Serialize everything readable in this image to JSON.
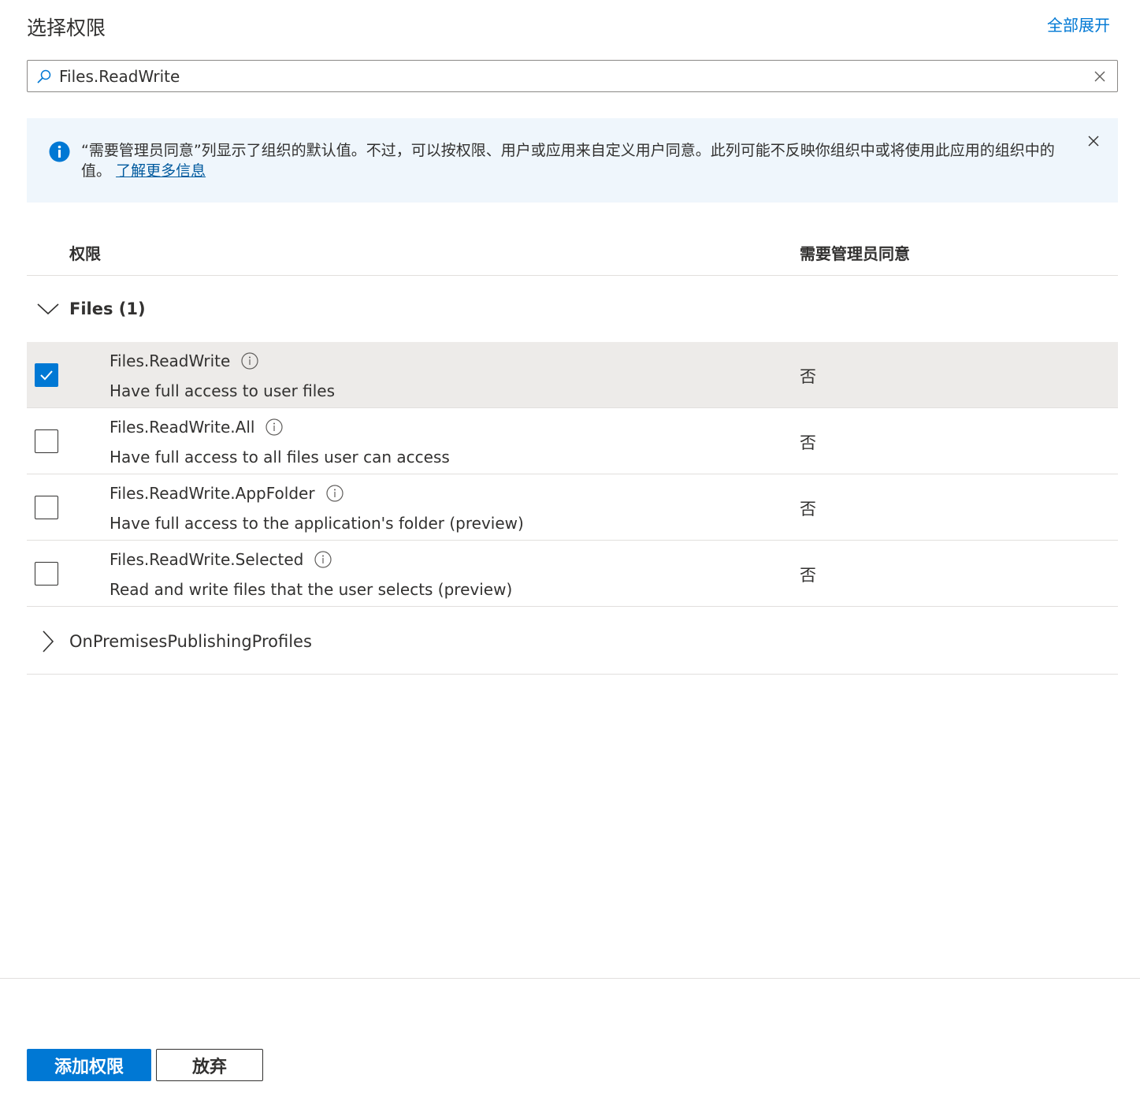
{
  "header": {
    "title": "选择权限",
    "expand_all": "全部展开"
  },
  "search": {
    "value": "Files.ReadWrite"
  },
  "info_bar": {
    "text": "“需要管理员同意”列显示了组织的默认值。不过，可以按权限、用户或应用来自定义用户同意。此列可能不反映你组织中或将使用此应用的组织中的值。",
    "link": "了解更多信息"
  },
  "table": {
    "col_permission": "权限",
    "col_admin_consent": "需要管理员同意"
  },
  "groups": [
    {
      "label": "Files (1)",
      "expanded": true,
      "items": [
        {
          "name": "Files.ReadWrite",
          "description": "Have full access to user files",
          "admin_consent": "否",
          "checked": true
        },
        {
          "name": "Files.ReadWrite.All",
          "description": "Have full access to all files user can access",
          "admin_consent": "否",
          "checked": false
        },
        {
          "name": "Files.ReadWrite.AppFolder",
          "description": "Have full access to the application's folder (preview)",
          "admin_consent": "否",
          "checked": false
        },
        {
          "name": "Files.ReadWrite.Selected",
          "description": "Read and write files that the user selects (preview)",
          "admin_consent": "否",
          "checked": false
        }
      ]
    },
    {
      "label": "OnPremisesPublishingProfiles",
      "expanded": false,
      "items": []
    }
  ],
  "footer": {
    "add_button": "添加权限",
    "discard_button": "放弃"
  },
  "colors": {
    "accent": "#0078d4",
    "selected_row": "#edebe9",
    "info_bg": "#eff6fc"
  }
}
